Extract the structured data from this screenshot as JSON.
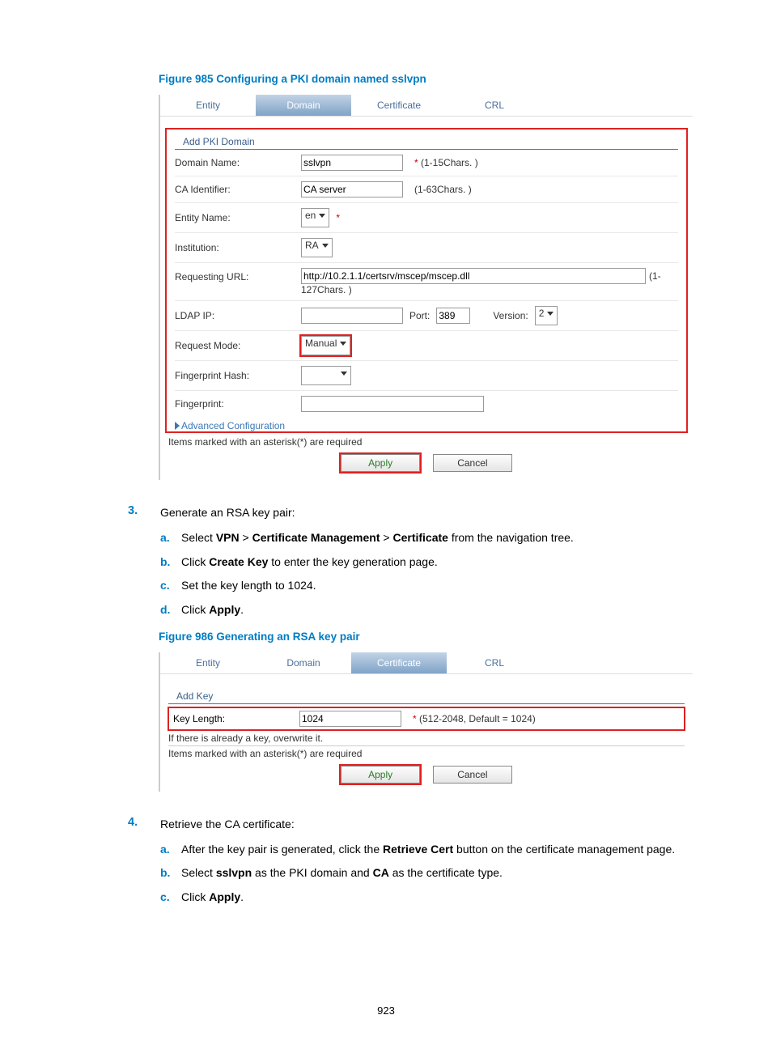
{
  "figure1": {
    "caption": "Figure 985 Configuring a PKI domain named sslvpn",
    "tabs": [
      "Entity",
      "Domain",
      "Certificate",
      "CRL"
    ],
    "activeTab": 1,
    "sectionTitle": "Add PKI Domain",
    "domainName": {
      "label": "Domain Name:",
      "value": "sslvpn",
      "hint": "(1-15Chars. )"
    },
    "caId": {
      "label": "CA Identifier:",
      "value": "CA server",
      "hint": "(1-63Chars. )"
    },
    "entityName": {
      "label": "Entity Name:",
      "value": "en"
    },
    "institution": {
      "label": "Institution:",
      "value": "RA"
    },
    "reqUrl": {
      "label": "Requesting URL:",
      "value": "http://10.2.1.1/certsrv/mscep/mscep.dll",
      "suffix1": "(1-",
      "suffix2": "127Chars. )"
    },
    "ldap": {
      "label": "LDAP IP:",
      "portLabel": "Port:",
      "portVal": "389",
      "verLabel": "Version:",
      "verVal": "2"
    },
    "reqMode": {
      "label": "Request Mode:",
      "value": "Manual"
    },
    "fpHash": {
      "label": "Fingerprint Hash:"
    },
    "fingerprint": {
      "label": "Fingerprint:"
    },
    "advanced": "Advanced Configuration",
    "reqNote": "Items marked with an asterisk(*) are required",
    "apply": "Apply",
    "cancel": "Cancel"
  },
  "step3": {
    "num": "3.",
    "title": "Generate an RSA key pair:",
    "a": {
      "pre": "Select ",
      "b1": "VPN",
      "gt1": " > ",
      "b2": "Certificate Management",
      "gt2": " > ",
      "b3": "Certificate",
      "post": " from the navigation tree."
    },
    "b": {
      "pre": "Click ",
      "b1": "Create Key",
      "post": " to enter the key generation page."
    },
    "c": "Set the key length to 1024.",
    "d": {
      "pre": "Click ",
      "b1": "Apply",
      "post": "."
    }
  },
  "figure2": {
    "caption": "Figure 986 Generating an RSA key pair",
    "tabs": [
      "Entity",
      "Domain",
      "Certificate",
      "CRL"
    ],
    "activeTab": 2,
    "sectionTitle": "Add Key",
    "keyLen": {
      "label": "Key Length:",
      "value": "1024",
      "hint": "(512-2048, Default = 1024)"
    },
    "note": "If there is already a key, overwrite it.",
    "reqNote": "Items marked with an asterisk(*) are required",
    "apply": "Apply",
    "cancel": "Cancel"
  },
  "step4": {
    "num": "4.",
    "title": "Retrieve the CA certificate:",
    "a": {
      "pre": "After the key pair is generated, click the ",
      "b1": "Retrieve Cert",
      "post": " button on the certificate management page."
    },
    "b": {
      "pre": "Select ",
      "b1": "sslvpn",
      "mid": " as the PKI domain and ",
      "b2": "CA",
      "post": " as the certificate type."
    },
    "c": {
      "pre": "Click ",
      "b1": "Apply",
      "post": "."
    }
  },
  "pageNumber": "923"
}
